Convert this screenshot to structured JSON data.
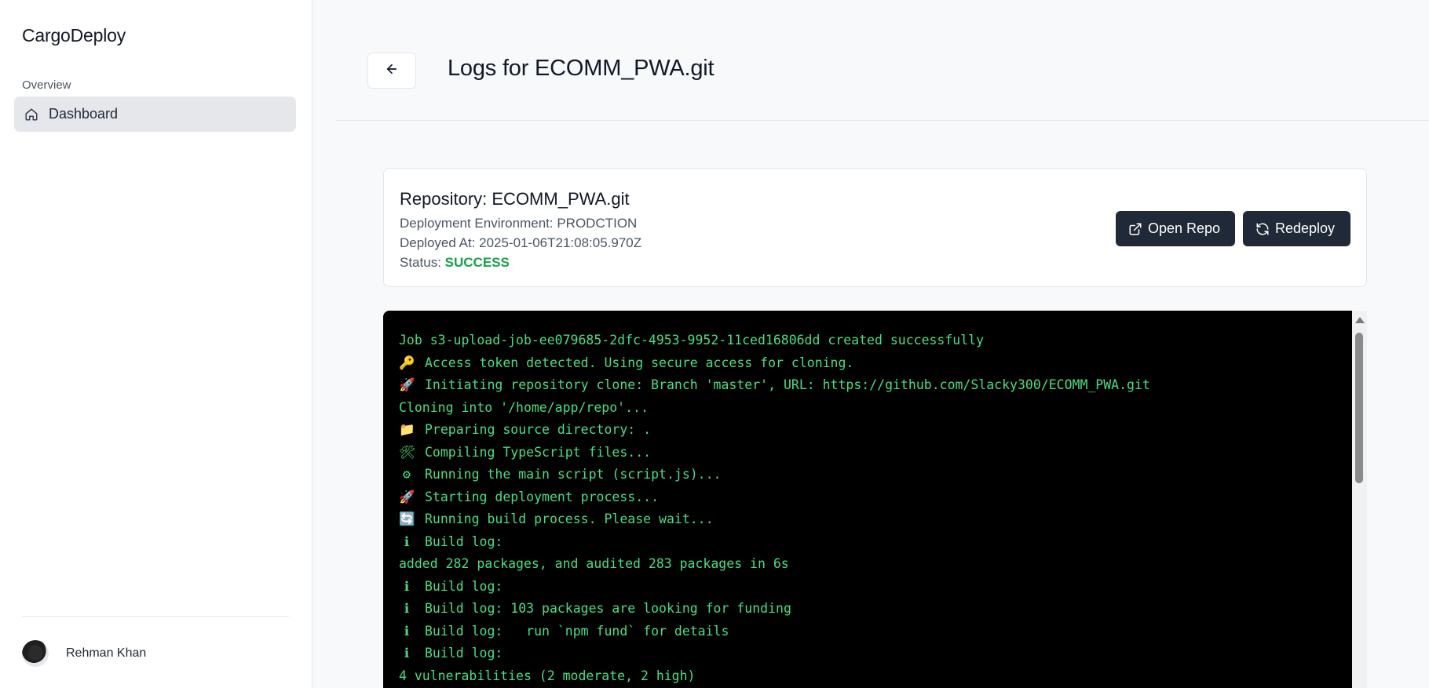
{
  "app": {
    "brand": "CargoDeploy"
  },
  "sidebar": {
    "section_label": "Overview",
    "items": [
      {
        "label": "Dashboard",
        "icon": "home-icon",
        "active": true
      }
    ],
    "user": {
      "name": "Rehman Khan"
    }
  },
  "header": {
    "title": "Logs for ECOMM_PWA.git",
    "back_icon": "arrow-left-icon"
  },
  "repository": {
    "title": "Repository: ECOMM_PWA.git",
    "environment_label": "Deployment Environment:",
    "environment": "PRODCTION",
    "deployed_label": "Deployed At:",
    "deployed_at": "2025-01-06T21:08:05.970Z",
    "status_label": "Status:",
    "status": "SUCCESS",
    "status_color": "#16a34a",
    "actions": {
      "open_repo": "Open Repo",
      "redeploy": "Redeploy"
    }
  },
  "logs": {
    "text_color": "#4ade80",
    "lines": [
      {
        "icon": "",
        "text": "Job s3-upload-job-ee079685-2dfc-4953-9952-11ced16806dd created successfully"
      },
      {
        "icon": "🔑",
        "text": "Access token detected. Using secure access for cloning."
      },
      {
        "icon": "🚀",
        "text": "Initiating repository clone: Branch 'master', URL: https://github.com/Slacky300/ECOMM_PWA.git"
      },
      {
        "icon": "",
        "text": "Cloning into '/home/app/repo'..."
      },
      {
        "icon": "📁",
        "text": "Preparing source directory: ."
      },
      {
        "icon": "🛠",
        "text": "Compiling TypeScript files..."
      },
      {
        "icon": "⚙",
        "text": "Running the main script (script.js)..."
      },
      {
        "icon": "🚀",
        "text": "Starting deployment process..."
      },
      {
        "icon": "🔄",
        "text": "Running build process. Please wait..."
      },
      {
        "icon": "ℹ",
        "text": "Build log:"
      },
      {
        "icon": "",
        "text": "added 282 packages, and audited 283 packages in 6s"
      },
      {
        "icon": "ℹ",
        "text": "Build log:"
      },
      {
        "icon": "ℹ",
        "text": "Build log: 103 packages are looking for funding"
      },
      {
        "icon": "ℹ",
        "text": "Build log:   run `npm fund` for details"
      },
      {
        "icon": "ℹ",
        "text": "Build log:"
      },
      {
        "icon": "",
        "text": "4 vulnerabilities (2 moderate, 2 high)"
      }
    ]
  }
}
